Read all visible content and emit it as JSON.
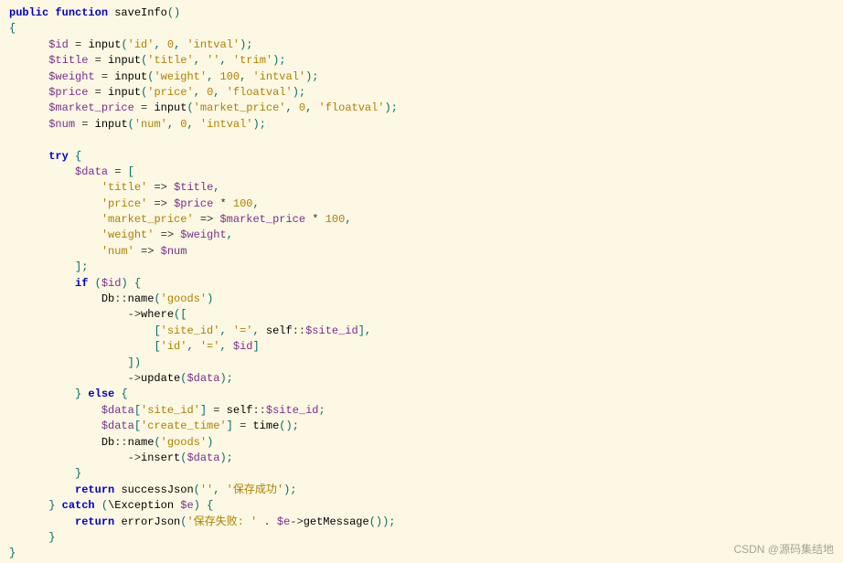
{
  "func_decl": {
    "kw1": "public",
    "kw2": "function",
    "name": "saveInfo"
  },
  "assign": {
    "id": {
      "v": "$id",
      "fn": "input",
      "a1": "'id'",
      "a2": "0",
      "a3": "'intval'"
    },
    "title": {
      "v": "$title",
      "fn": "input",
      "a1": "'title'",
      "a2": "''",
      "a3": "'trim'"
    },
    "weight": {
      "v": "$weight",
      "fn": "input",
      "a1": "'weight'",
      "a2": "100",
      "a3": "'intval'"
    },
    "price": {
      "v": "$price",
      "fn": "input",
      "a1": "'price'",
      "a2": "0",
      "a3": "'floatval'"
    },
    "mprice": {
      "v": "$market_price",
      "fn": "input",
      "a1": "'market_price'",
      "a2": "0",
      "a3": "'floatval'"
    },
    "num": {
      "v": "$num",
      "fn": "input",
      "a1": "'num'",
      "a2": "0",
      "a3": "'intval'"
    }
  },
  "kw": {
    "try": "try",
    "if": "if",
    "else": "else",
    "catch": "catch",
    "return": "return"
  },
  "data_var": "$data",
  "arr": {
    "k_title": "'title'",
    "v_title": "$title",
    "k_price": "'price'",
    "v_price": "$price",
    "mul": "*",
    "hundred": "100",
    "k_mprice": "'market_price'",
    "v_mprice": "$market_price",
    "k_weight": "'weight'",
    "v_weight": "$weight",
    "k_num": "'num'",
    "v_num": "$num"
  },
  "id_var": "$id",
  "db": {
    "cls": "Db",
    "name_fn": "name",
    "name_arg": "'goods'",
    "where_fn": "where",
    "update_fn": "update",
    "insert_fn": "insert"
  },
  "where": {
    "site_k": "'site_id'",
    "eq": "'='",
    "self": "self",
    "site_v": "$site_id",
    "id_k": "'id'",
    "id_v": "$id"
  },
  "else_block": {
    "site_key": "'site_id'",
    "self": "self",
    "site_v": "$site_id",
    "ct_key": "'create_time'",
    "time_fn": "time"
  },
  "ret_ok": {
    "fn": "successJson",
    "a1": "''",
    "a2": "'保存成功'"
  },
  "catch_block": {
    "cls": "\\Exception",
    "var": "$e"
  },
  "ret_err": {
    "fn": "errorJson",
    "a1": "'保存失败: '",
    "concat": ".",
    "obj": "$e",
    "m": "getMessage"
  },
  "watermark": "CSDN @源码集结地"
}
